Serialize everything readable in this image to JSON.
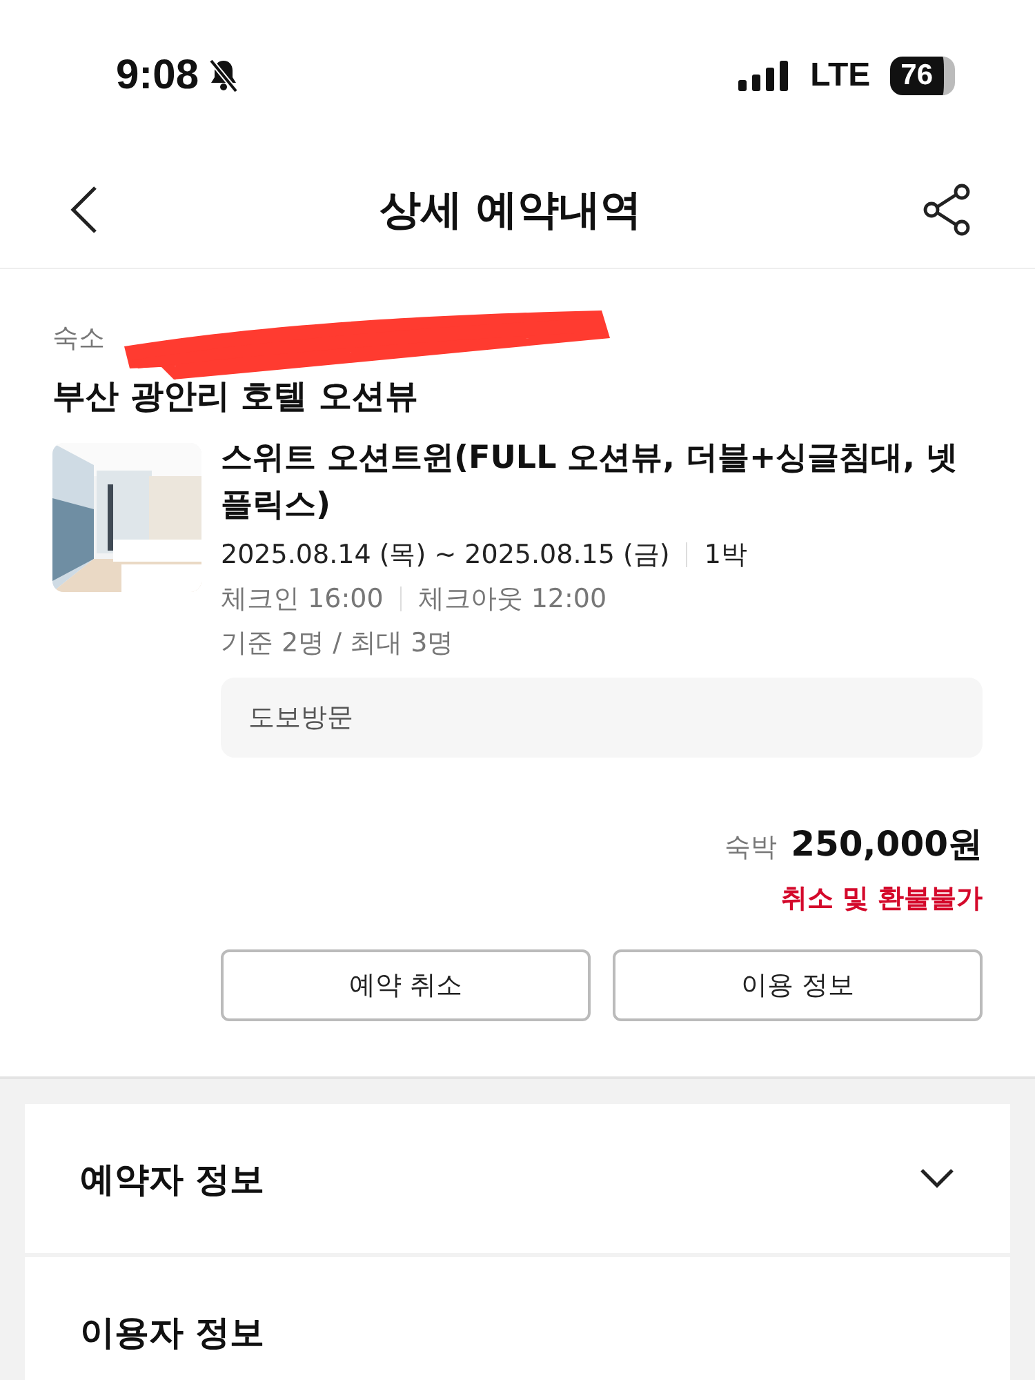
{
  "status_bar": {
    "time": "9:08",
    "network": "LTE",
    "battery": "76",
    "silent": true
  },
  "header": {
    "title": "상세 예약내역"
  },
  "booking": {
    "label": "숙소",
    "redacted": true,
    "hotel": "부산 광안리 호텔 오션뷰",
    "room": {
      "name": "스위트 오션트윈(FULL 오션뷰, 더블+싱글침대, 넷플릭스)",
      "dates": "2025.08.14 (목) ~ 2025.08.15 (금)",
      "nights": "1박",
      "checkin": "체크인 16:00",
      "checkout": "체크아웃 12:00",
      "capacity": "기준 2명 / 최대 3명",
      "visit": "도보방문"
    },
    "price_label": "숙박",
    "price": "250,000원",
    "refund_note": "취소 및 환불불가",
    "buttons": [
      "예약 취소",
      "이용 정보"
    ]
  },
  "sections": [
    {
      "title": "예약자 정보"
    },
    {
      "title": "이용자 정보"
    }
  ]
}
